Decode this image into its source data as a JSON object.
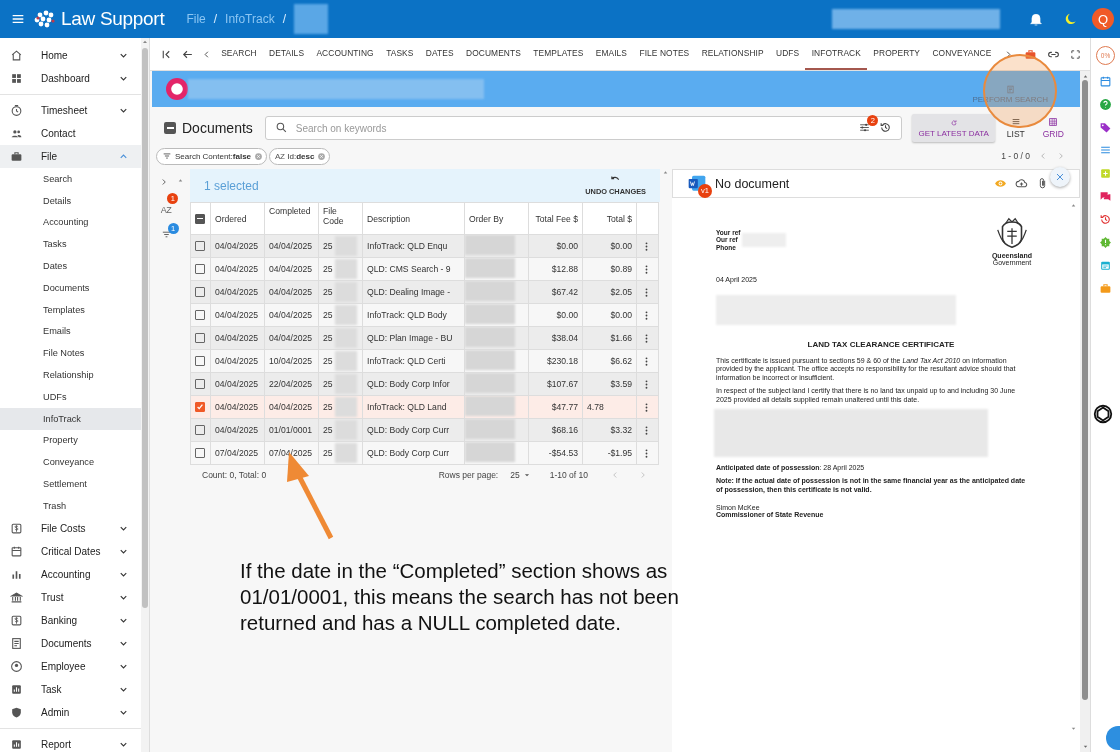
{
  "topbar": {
    "app_name": "Law Support",
    "breadcrumb": [
      {
        "label": "File",
        "separator": "/"
      },
      {
        "label": "InfoTrack",
        "separator": "/"
      }
    ],
    "avatar": "Q"
  },
  "sidebar": {
    "items": [
      {
        "label": "Home",
        "expandable": true,
        "expanded": false
      },
      {
        "label": "Dashboard",
        "expandable": true,
        "expanded": false
      },
      {
        "label": "Timesheet",
        "expandable": true,
        "expanded": false
      },
      {
        "label": "Contact",
        "expandable": false,
        "expanded": false
      },
      {
        "label": "File",
        "expandable": true,
        "expanded": true,
        "children": [
          {
            "label": "Search",
            "selected": false
          },
          {
            "label": "Details",
            "selected": false
          },
          {
            "label": "Accounting",
            "selected": false
          },
          {
            "label": "Tasks",
            "selected": false
          },
          {
            "label": "Dates",
            "selected": false
          },
          {
            "label": "Documents",
            "selected": false
          },
          {
            "label": "Templates",
            "selected": false
          },
          {
            "label": "Emails",
            "selected": false
          },
          {
            "label": "File Notes",
            "selected": false
          },
          {
            "label": "Relationship",
            "selected": false
          },
          {
            "label": "UDFs",
            "selected": false
          },
          {
            "label": "InfoTrack",
            "selected": true
          },
          {
            "label": "Property",
            "selected": false
          },
          {
            "label": "Conveyance",
            "selected": false
          },
          {
            "label": "Settlement",
            "selected": false
          },
          {
            "label": "Trash",
            "selected": false
          }
        ]
      },
      {
        "label": "File Costs",
        "expandable": true,
        "expanded": false
      },
      {
        "label": "Critical Dates",
        "expandable": true,
        "expanded": false
      },
      {
        "label": "Accounting",
        "expandable": true,
        "expanded": false
      },
      {
        "label": "Trust",
        "expandable": true,
        "expanded": false
      },
      {
        "label": "Banking",
        "expandable": true,
        "expanded": false
      },
      {
        "label": "Documents",
        "expandable": true,
        "expanded": false
      },
      {
        "label": "Employee",
        "expandable": true,
        "expanded": false
      },
      {
        "label": "Task",
        "expandable": true,
        "expanded": false
      },
      {
        "label": "Admin",
        "expandable": true,
        "expanded": false
      },
      {
        "label": "Report",
        "expandable": true,
        "expanded": false
      }
    ]
  },
  "tabs": [
    {
      "label": "SEARCH",
      "selected": false
    },
    {
      "label": "DETAILS",
      "selected": false
    },
    {
      "label": "ACCOUNTING",
      "selected": false
    },
    {
      "label": "TASKS",
      "selected": false
    },
    {
      "label": "DATES",
      "selected": false
    },
    {
      "label": "DOCUMENTS",
      "selected": false
    },
    {
      "label": "TEMPLATES",
      "selected": false
    },
    {
      "label": "EMAILS",
      "selected": false
    },
    {
      "label": "FILE NOTES",
      "selected": false
    },
    {
      "label": "RELATIONSHIP",
      "selected": false
    },
    {
      "label": "UDFS",
      "selected": false
    },
    {
      "label": "INFOTRACK",
      "selected": true
    },
    {
      "label": "PROPERTY",
      "selected": false
    },
    {
      "label": "CONVEYANCE",
      "selected": false
    }
  ],
  "banner": {
    "action": "PERFORM SEARCH",
    "action_disabled": true
  },
  "documents": {
    "title": "Documents",
    "search_placeholder": "Search on keywords",
    "filter_badge": "2",
    "refresh_button": "GET LATEST DATA",
    "views": [
      {
        "label": "LIST",
        "selected": false
      },
      {
        "label": "GRID",
        "selected": true
      }
    ],
    "chips": [
      {
        "kind": "filter",
        "label": "Search Content:",
        "value": "false"
      },
      {
        "kind": "sort",
        "icon_text": "AZ",
        "label": "Id:",
        "value": "desc"
      }
    ],
    "sort_label": "AZ",
    "pager": "1 - 0 / 0",
    "sort_badge": "1",
    "filter_count_badge": "1"
  },
  "table": {
    "select_all_indeterminate": true,
    "selection_text": "1 selected",
    "undo": "UNDO CHANGES",
    "columns": [
      "Ordered",
      "Completed",
      "File Code",
      "Description",
      "Order By",
      "Total Fee $",
      "Total $"
    ],
    "rows": [
      {
        "checked": false,
        "editing": false,
        "ordered": "04/04/2025",
        "completed": "04/04/2025",
        "file_code": "25",
        "description": "InfoTrack: QLD Enqu",
        "total_fee": "$0.00",
        "total": "$0.00"
      },
      {
        "checked": false,
        "editing": false,
        "ordered": "04/04/2025",
        "completed": "04/04/2025",
        "file_code": "25",
        "description": "QLD: CMS Search - 9",
        "total_fee": "$12.88",
        "total": "$0.89"
      },
      {
        "checked": false,
        "editing": false,
        "ordered": "04/04/2025",
        "completed": "04/04/2025",
        "file_code": "25",
        "description": "QLD: Dealing Image -",
        "total_fee": "$67.42",
        "total": "$2.05"
      },
      {
        "checked": false,
        "editing": false,
        "ordered": "04/04/2025",
        "completed": "04/04/2025",
        "file_code": "25",
        "description": "InfoTrack: QLD Body",
        "total_fee": "$0.00",
        "total": "$0.00"
      },
      {
        "checked": false,
        "editing": false,
        "ordered": "04/04/2025",
        "completed": "04/04/2025",
        "file_code": "25",
        "description": "QLD: Plan Image - BU",
        "total_fee": "$38.04",
        "total": "$1.66"
      },
      {
        "checked": false,
        "editing": false,
        "ordered": "04/04/2025",
        "completed": "10/04/2025",
        "file_code": "25",
        "description": "InfoTrack: QLD Certi",
        "total_fee": "$230.18",
        "total": "$6.62"
      },
      {
        "checked": false,
        "editing": false,
        "ordered": "04/04/2025",
        "completed": "22/04/2025",
        "file_code": "25",
        "description": "QLD: Body Corp Infor",
        "total_fee": "$107.67",
        "total": "$3.59"
      },
      {
        "checked": true,
        "editing": true,
        "ordered": "04/04/2025",
        "completed": "04/04/2025",
        "file_code": "25",
        "description": "InfoTrack: QLD Land",
        "total_fee": "$47.77",
        "total": "4.78"
      },
      {
        "checked": false,
        "editing": false,
        "ordered": "04/04/2025",
        "completed": "01/01/0001",
        "file_code": "25",
        "description": "QLD: Body Corp Curr",
        "total_fee": "$68.16",
        "total": "$3.32"
      },
      {
        "checked": false,
        "editing": false,
        "ordered": "07/04/2025",
        "completed": "07/04/2025",
        "file_code": "25",
        "description": "QLD: Body Corp Curr",
        "total_fee": "-$54.53",
        "total": "-$1.95"
      }
    ],
    "footer": {
      "count": "Count: 0, Total: 0",
      "rows_label": "Rows per page:",
      "rows_value": "25",
      "range": "1-10 of 10"
    }
  },
  "preview": {
    "title": "No document",
    "version": "v1",
    "letter": {
      "refs": [
        "Your ref",
        "Our ref",
        "Phone"
      ],
      "date": "04 April 2025",
      "crest_lines": [
        "Queensland",
        "Government"
      ],
      "heading": "LAND TAX CLEARANCE CERTIFICATE",
      "paragraphs": [
        "This certificate is issued pursuant to sections 59 & 60 of the *Land Tax Act 2010* on information provided by the applicant.  The office accepts no responsibility for the resultant advice should that information be incorrect or insufficient.",
        "In respect of the subject land I certify that there is no land tax unpaid up to and including 30 June 2025 provided all details supplied remain unaltered until this date."
      ],
      "possession": "**Anticipated date of possession**: 28 April 2025",
      "note": "Note: If the actual date of possession is not in the same financial year as the anticipated date of possession, then this certificate is not valid.",
      "signatory": "Simon McKee",
      "signatory_title": "Commissioner of State Revenue"
    }
  },
  "rail": {
    "progress": "0%"
  },
  "annotation": {
    "text": "If the date in the “Completed” section shows as 01/01/0001, this means the search has not been returned and has a NULL completed date."
  }
}
